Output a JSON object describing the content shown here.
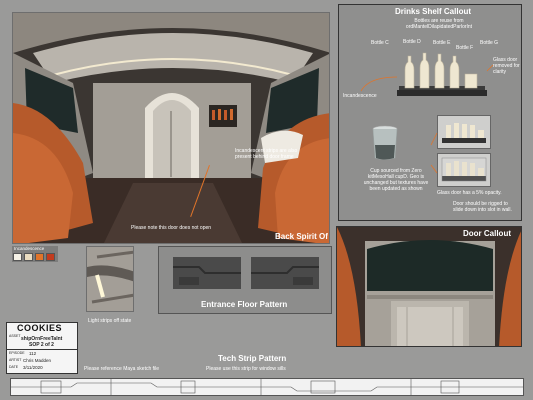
{
  "main_view": {
    "title": "Back Spirit Of",
    "note_incandescent": "Incandescent strips are also present behind door frame",
    "note_door": "Please note this door does not open"
  },
  "incandescence_legend": {
    "label": "Incandescence",
    "swatches": [
      "#f5f1e6",
      "#e9dcc0",
      "#e0742a",
      "#c23b1e"
    ]
  },
  "light_strips": {
    "caption": "Light strips off state"
  },
  "entrance_floor": {
    "title": "Entrance Floor Pattern"
  },
  "drinks_shelf": {
    "title": "Drinks Shelf Callout",
    "subtitle": "Bottles are reuse from ordMantelDilapidatedParlorInt",
    "bottles": [
      "Bottle C",
      "Bottle D",
      "Bottle E",
      "Bottle F",
      "Bottle G"
    ],
    "incandescence_label": "Incandescence",
    "glass_door_note": "Glass door removed for clarity",
    "cup_note": "Cup sourced from Zero kitMesoHall cupD. Geo is unchanged but textures have been updated as shown",
    "opacity_note": "Glass door has a 5% opacity.",
    "rig_note": "Door should be rigged to slide down into slot in wall."
  },
  "door_callout": {
    "title": "Door Callout"
  },
  "info_block": {
    "logo": "COOKIES",
    "asset_label": "ASSET",
    "asset_value": "shipOrnFreeTaInt",
    "sop": "SOP 2 of 2",
    "episode_label": "EPISODE",
    "episode_value": "112",
    "artist_label": "ARTIST",
    "artist_value": "Chris Madden",
    "date_label": "DATE",
    "date_value": "3/11/2020",
    "maya_note": "Please reference Maya sketch file"
  },
  "tech_strip": {
    "title": "Tech Strip Pattern",
    "note": "Please use this strip for window sills"
  }
}
